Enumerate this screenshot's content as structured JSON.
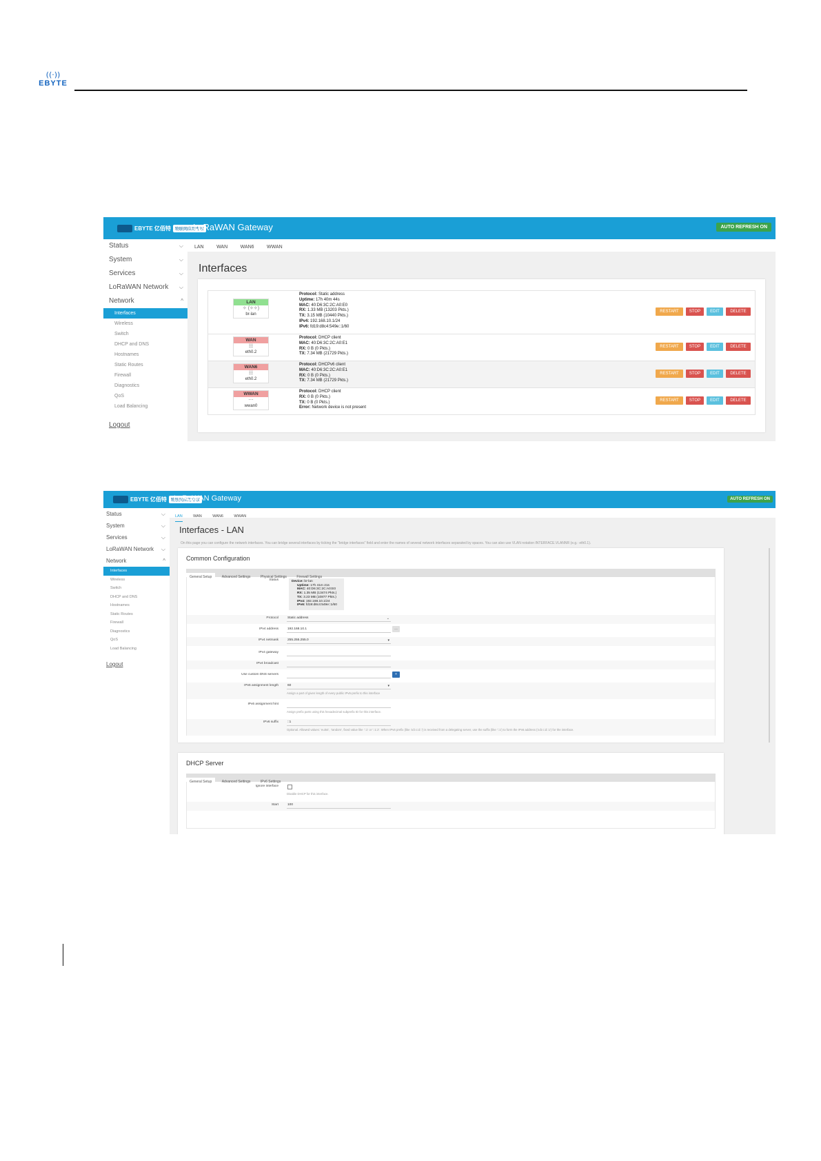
{
  "document": {
    "logo_text": "EBYTE"
  },
  "gateway": {
    "title": "LoRaWAN Gateway",
    "brand_text": "EBYTE 亿佰特",
    "brand_tag": "物联网应用专家",
    "auto_refresh": "AUTO REFRESH ON",
    "logout": "Logout",
    "sidebar": {
      "status": "Status",
      "system": "System",
      "services": "Services",
      "lorawan_network": "LoRaWAN Network",
      "network": "Network",
      "sub": {
        "interfaces": "Interfaces",
        "wireless": "Wireless",
        "switch": "Switch",
        "dhcp_dns": "DHCP and DNS",
        "hostnames": "Hostnames",
        "static_routes": "Static Routes",
        "firewall": "Firewall",
        "diagnostics": "Diagnostics",
        "qos": "QoS",
        "load_balancing": "Load Balancing"
      }
    },
    "tabs": {
      "lan": "LAN",
      "wan": "WAN",
      "wan6": "WAN6",
      "wwan": "WWAN"
    }
  },
  "interfaces_page": {
    "heading": "Interfaces",
    "buttons": {
      "restart": "RESTART",
      "stop": "STOP",
      "edit": "EDIT",
      "delete": "DELETE"
    },
    "rows": [
      {
        "name": "LAN",
        "color": "#90e090",
        "icon": "network-bridge-icon",
        "icon_glyph": "✧ (✧✧)",
        "device": "br-lan",
        "lines": [
          {
            "k": "Protocol:",
            "v": "Static address"
          },
          {
            "k": "Uptime:",
            "v": "17h 40m 44s"
          },
          {
            "k": "MAC:",
            "v": "40:D6:3C:2C:A0:E0"
          },
          {
            "k": "RX:",
            "v": "1.33 MB (13203 Pkts.)"
          },
          {
            "k": "TX:",
            "v": "3.15 MB (10440 Pkts.)"
          },
          {
            "k": "IPv4:",
            "v": "192.168.10.1/24"
          },
          {
            "k": "IPv6:",
            "v": "fd19:d8c4:549e::1/60"
          }
        ]
      },
      {
        "name": "WAN",
        "color": "#f0a0a0",
        "icon": "ethernet-port-icon",
        "icon_glyph": "☷",
        "device": "eth0.2",
        "lines": [
          {
            "k": "Protocol:",
            "v": "DHCP client"
          },
          {
            "k": "MAC:",
            "v": "40:D6:3C:2C:A0:E1"
          },
          {
            "k": "RX:",
            "v": "0 B (0 Pkts.)"
          },
          {
            "k": "TX:",
            "v": "7.34 MB (21729 Pkts.)"
          }
        ]
      },
      {
        "name": "WAN6",
        "color": "#f0a0a0",
        "icon": "ethernet-port-icon",
        "icon_glyph": "☷",
        "device": "eth0.2",
        "lines": [
          {
            "k": "Protocol:",
            "v": "DHCPv6 client"
          },
          {
            "k": "MAC:",
            "v": "40:D6:3C:2C:A0:E1"
          },
          {
            "k": "RX:",
            "v": "0 B (0 Pkts.)"
          },
          {
            "k": "TX:",
            "v": "7.34 MB (21729 Pkts.)"
          }
        ]
      },
      {
        "name": "WWAN",
        "color": "#f0a0a0",
        "icon": "wireless-icon",
        "icon_glyph": "⋯",
        "device": "wwan0",
        "lines": [
          {
            "k": "Protocol:",
            "v": "DHCP client"
          },
          {
            "k": "RX:",
            "v": "0 B (0 Pkts.)"
          },
          {
            "k": "TX:",
            "v": "0 B (0 Pkts.)"
          },
          {
            "k": "Error:",
            "v": "Network device is not present"
          }
        ]
      }
    ]
  },
  "lan_page": {
    "heading": "Interfaces - LAN",
    "intro": "On this page you can configure the network interfaces. You can bridge several interfaces by ticking the \"bridge interfaces\" field and enter the names of several network interfaces separated by spaces. You can also use VLAN notation INTERFACE.VLANNR (e.g.: eth0.1).",
    "common_title": "Common Configuration",
    "subtabs": {
      "general": "General Setup",
      "advanced": "Advanced Settings",
      "physical": "Physical Settings",
      "firewall": "Firewall Settings"
    },
    "status_label": "Status",
    "status_lines": [
      {
        "k": "Device:",
        "v": "br-lan"
      },
      {
        "k": "Uptime:",
        "v": "17h 41m 21s"
      },
      {
        "k": "MAC:",
        "v": "40:D6:3C:2C:A0:E0"
      },
      {
        "k": "RX:",
        "v": "1.35 MB (13474 Pkts.)"
      },
      {
        "k": "TX:",
        "v": "3.23 MB (10877 Pkts.)"
      },
      {
        "k": "IPv4:",
        "v": "192.168.10.1/24"
      },
      {
        "k": "IPv6:",
        "v": "fd19:d8c4:549e::1/60"
      }
    ],
    "fields": {
      "protocol_label": "Protocol",
      "protocol_value": "Static address",
      "ipv4_addr_label": "IPv4 address",
      "ipv4_addr_value": "192.168.10.1",
      "netmask_label": "IPv4 netmask",
      "netmask_value": "255.255.255.0",
      "gateway_label": "IPv4 gateway",
      "broadcast_label": "IPv4 broadcast",
      "dns_label": "Use custom DNS servers",
      "ipv6_len_label": "IPv6 assignment length",
      "ipv6_len_value": "60",
      "ipv6_len_hint": "Assign a part of given length of every public IPv6-prefix to this interface",
      "ipv6_hint_label": "IPv6 assignment hint",
      "ipv6_hint_hint": "Assign prefix parts using this hexadecimal subprefix ID for this interface.",
      "ipv6_suffix_label": "IPv6 suffix",
      "ipv6_suffix_value": "::1",
      "ipv6_suffix_hint": "Optional. Allowed values: 'eui64', 'random', fixed value like '::1' or '::1:2'. When IPv6 prefix (like 'a:b:c:d::') is received from a delegating server, use the suffix (like '::1') to form the IPv6 address ('a:b:c:d::1') for the interface."
    },
    "dhcp": {
      "title": "DHCP Server",
      "subtabs": {
        "general": "General Setup",
        "advanced": "Advanced Settings",
        "ipv6": "IPv6 Settings"
      },
      "ignore_label": "Ignore interface",
      "ignore_hint": "Disable DHCP for this interface.",
      "start_label": "Start",
      "start_value": "100"
    }
  }
}
